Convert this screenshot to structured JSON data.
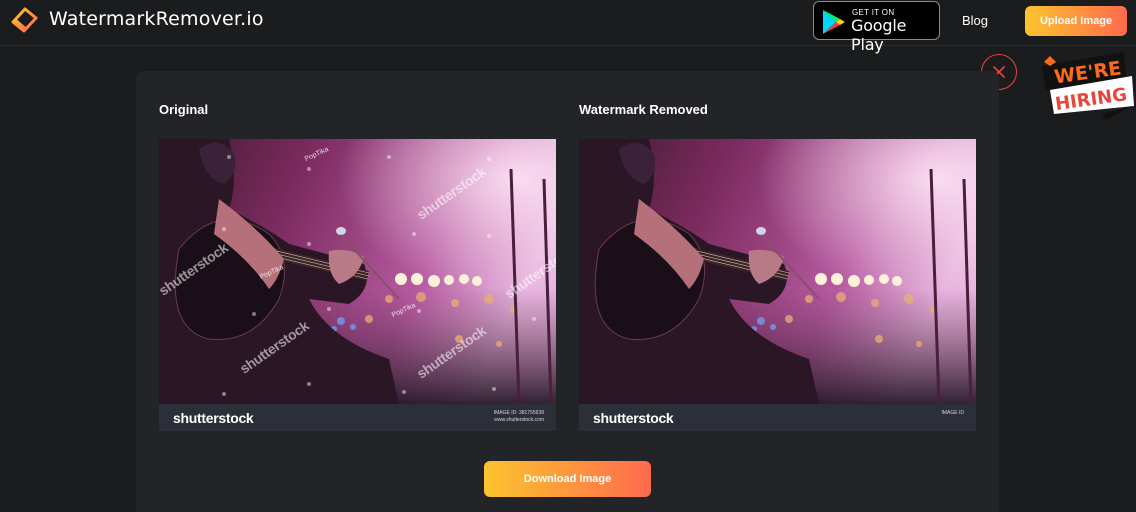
{
  "header": {
    "brand": "WatermarkRemover.io",
    "google_play": {
      "small": "GET IT ON",
      "big": "Google Play"
    },
    "blog_label": "Blog",
    "upload_label": "Upload Image"
  },
  "hiring_badge": {
    "line1": "WE'RE",
    "line2": "HIRING"
  },
  "panel": {
    "original_label": "Original",
    "removed_label": "Watermark Removed",
    "download_label": "Download Image"
  },
  "image": {
    "footer_brand": "shutterstock",
    "footer_meta_line1": "IMAGE ID: 381755638",
    "footer_meta_line2": "www.shutterstock.com",
    "removed_meta_line1": "IMAGE ID",
    "watermark_text": "shutterstock",
    "small_watermark": "PopTika"
  },
  "colors": {
    "accent_start": "#fcc42e",
    "accent_end": "#ff6a4d",
    "close_red": "#e8453a",
    "background": "#1b1c1e",
    "panel": "#232427"
  }
}
